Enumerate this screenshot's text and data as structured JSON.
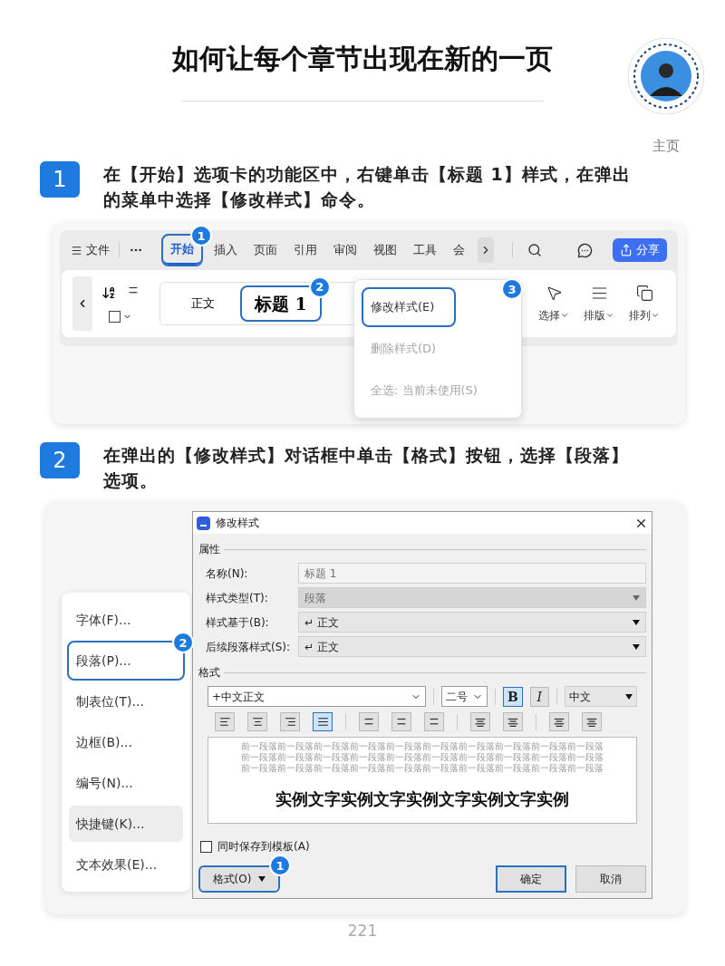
{
  "title": "如何让每个章节出现在新的一页",
  "profile": {
    "label": "主页"
  },
  "steps": [
    {
      "number": "1",
      "text": "在【开始】选项卡的功能区中，右键单击【标题 1】样式，在弹出的菜单中选择【修改样式】命令。"
    },
    {
      "number": "2",
      "text": "在弹出的【修改样式】对话框中单击【格式】按钮，选择【段落】选项。"
    }
  ],
  "ribbon": {
    "file_tab": "文件",
    "tabs": [
      {
        "label": "开始",
        "selected": true,
        "callout": "1"
      },
      {
        "label": "插入",
        "selected": false
      },
      {
        "label": "页面",
        "selected": false
      },
      {
        "label": "引用",
        "selected": false
      },
      {
        "label": "审阅",
        "selected": false
      },
      {
        "label": "视图",
        "selected": false
      },
      {
        "label": "工具",
        "selected": false
      },
      {
        "label": "会",
        "selected": false
      }
    ],
    "share_button": "分享",
    "styles": [
      {
        "label": "正文",
        "kind": "normal"
      },
      {
        "label": "标题 1",
        "kind": "heading",
        "callout": "2"
      }
    ],
    "tools": [
      {
        "label": "选择",
        "kind": "select"
      },
      {
        "label": "排版",
        "kind": "layout"
      },
      {
        "label": "排列",
        "kind": "arrange"
      }
    ],
    "context_menu": [
      {
        "label": "修改样式(E)",
        "disabled": false,
        "callout": "3"
      },
      {
        "label": "删除样式(D)",
        "disabled": true
      },
      {
        "label": "全选: 当前未使用(S)",
        "disabled": true
      }
    ]
  },
  "format_menu": [
    {
      "label": "字体(F)...",
      "hovered": false
    },
    {
      "label": "段落(P)...",
      "hovered": false,
      "callout": "2"
    },
    {
      "label": "制表位(T)...",
      "hovered": false
    },
    {
      "label": "边框(B)...",
      "hovered": false
    },
    {
      "label": "编号(N)...",
      "hovered": false
    },
    {
      "label": "快捷键(K)...",
      "hovered": true
    },
    {
      "label": "文本效果(E)...",
      "hovered": false
    }
  ],
  "dialog": {
    "title": "修改样式",
    "properties_label": "属性",
    "fields": [
      {
        "label": "名称(N):",
        "value": "标题 1",
        "kind": "text",
        "disabled": true
      },
      {
        "label": "样式类型(T):",
        "value": "段落",
        "kind": "select",
        "disabled": true
      },
      {
        "label": "样式基于(B):",
        "value": "↵ 正文",
        "kind": "select",
        "disabled": false
      },
      {
        "label": "后续段落样式(S):",
        "value": "↵ 正文",
        "kind": "select",
        "disabled": false
      }
    ],
    "format_label": "格式",
    "font": "+中文正文",
    "size": "二号",
    "style_buttons": [
      {
        "label": "B",
        "kind": "bold",
        "selected": true
      },
      {
        "label": "I",
        "kind": "italic",
        "selected": false
      }
    ],
    "script": "中文",
    "alignments": [
      {
        "kind": "left",
        "selected": false
      },
      {
        "kind": "center",
        "selected": false
      },
      {
        "kind": "right",
        "selected": false
      },
      {
        "kind": "justify",
        "selected": true
      }
    ],
    "preview_lines": [
      "前一段落前一段落前一段落前一段落前一段落前一段落前一段落前一段落前一段落前一段落",
      "前一段落前一段落前一段落前一段落前一段落前一段落前一段落前一段落前一段落前一段落",
      "前一段落前一段落前一段落前一段落前一段落前一段落前一段落前一段落前一段落前一段落"
    ],
    "sample": "实例文字实例文字实例文字实例文字实例",
    "save_to_template": {
      "label": "同时保存到模板(A)",
      "checked": false
    },
    "format_button": {
      "label": "格式(O)",
      "callout": "1"
    },
    "ok_button": "确定",
    "cancel_button": "取消"
  },
  "page_number": "221"
}
